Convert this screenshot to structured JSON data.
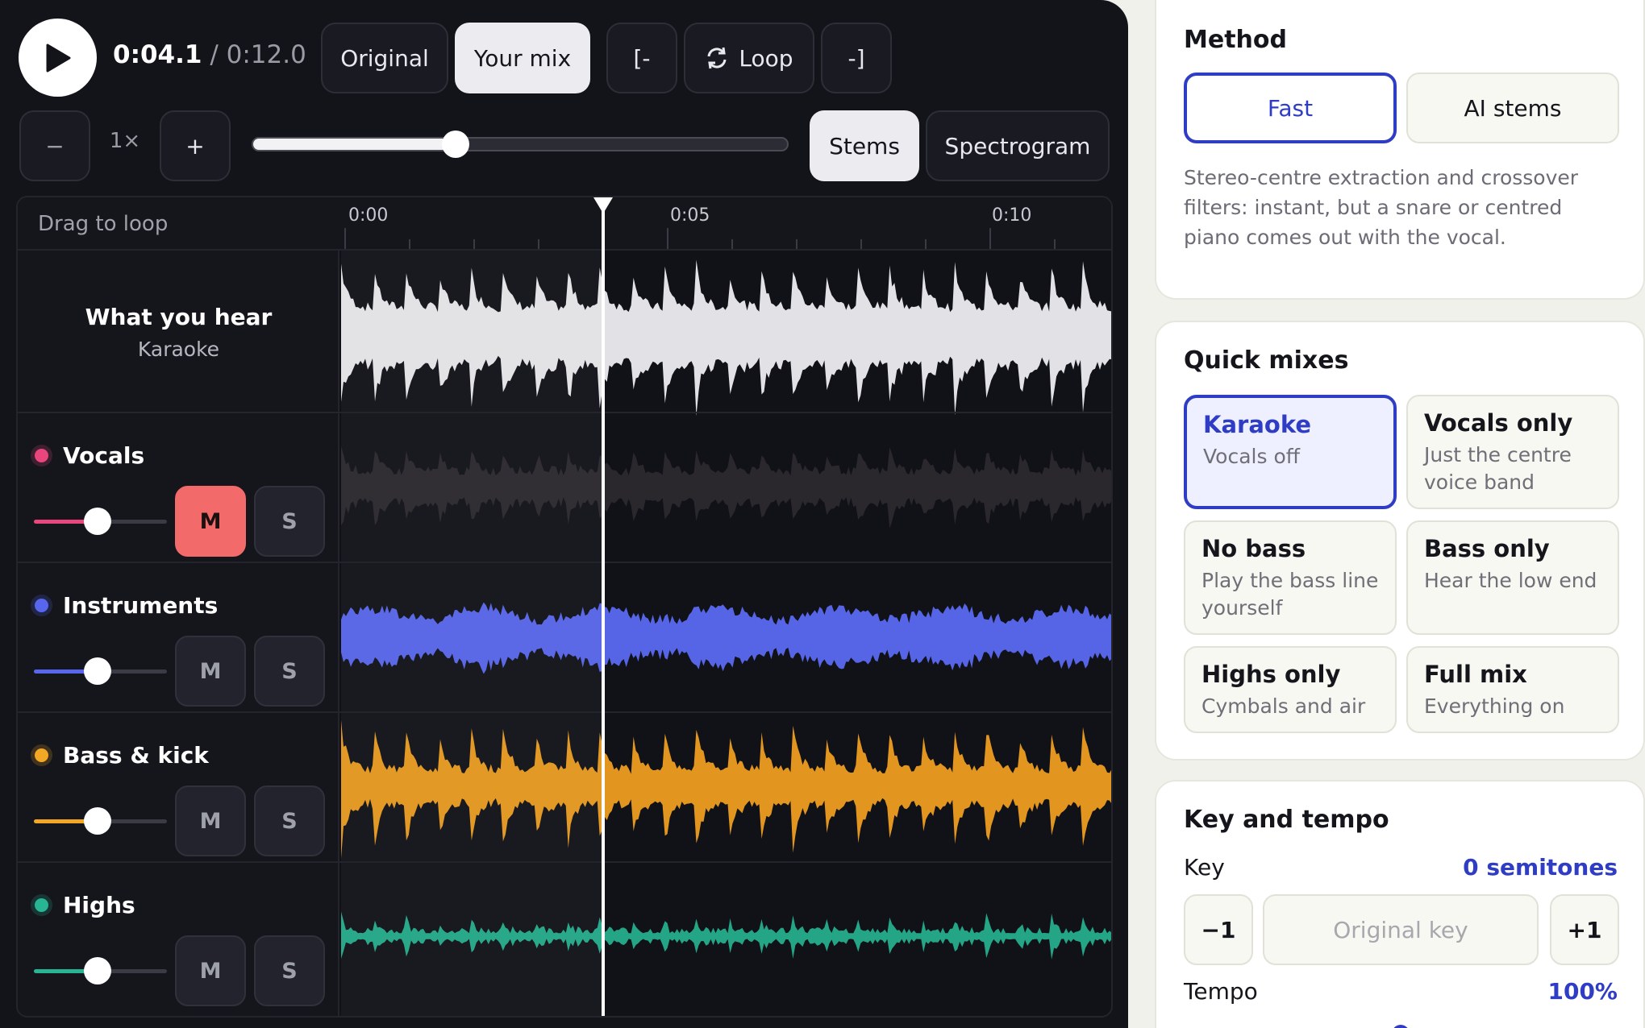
{
  "player": {
    "current_time": "0:04.1",
    "separator": "/",
    "total_time": "0:12.0",
    "mode_original": "Original",
    "mode_mix": "Your mix",
    "loop_start": "[-",
    "loop_label": "Loop",
    "loop_end": "-]",
    "speed_minus": "−",
    "speed_value": "1×",
    "speed_plus": "+",
    "zoom_level": 0.38,
    "view_stems": "Stems",
    "view_spectrogram": "Spectrogram",
    "playhead_time_s": 4.1,
    "duration_s": 12.0
  },
  "timeline": {
    "drag_label": "Drag to loop",
    "ticks": [
      "0:00",
      "0:05",
      "0:10"
    ],
    "hear_title": "What you hear",
    "hear_subtitle": "Karaoke"
  },
  "stems": [
    {
      "name": "Vocals",
      "color": "#e8467c",
      "level": 0.62,
      "mute": "M",
      "solo": "S",
      "muted": true
    },
    {
      "name": "Instruments",
      "color": "#5766ec",
      "level": 0.62,
      "mute": "M",
      "solo": "S",
      "muted": false
    },
    {
      "name": "Bass & kick",
      "color": "#f2a725",
      "level": 0.62,
      "mute": "M",
      "solo": "S",
      "muted": false
    },
    {
      "name": "Highs",
      "color": "#27b594",
      "level": 0.62,
      "mute": "M",
      "solo": "S",
      "muted": false
    }
  ],
  "method": {
    "title": "Method",
    "fast": "Fast",
    "ai": "AI stems",
    "description": "Stereo-centre extraction and crossover filters: instant, but a snare or centred piano comes out with the vocal."
  },
  "quick_mixes": {
    "title": "Quick mixes",
    "items": [
      {
        "title": "Karaoke",
        "subtitle": "Vocals off"
      },
      {
        "title": "Vocals only",
        "subtitle": "Just the centre voice band"
      },
      {
        "title": "No bass",
        "subtitle": "Play the bass line yourself"
      },
      {
        "title": "Bass only",
        "subtitle": "Hear the low end"
      },
      {
        "title": "Highs only",
        "subtitle": "Cymbals and air"
      },
      {
        "title": "Full mix",
        "subtitle": "Everything on"
      }
    ]
  },
  "key_tempo": {
    "title": "Key and tempo",
    "key_label": "Key",
    "key_value": "0 semitones",
    "minus": "−1",
    "original_key": "Original key",
    "plus": "+1",
    "tempo_label": "Tempo",
    "tempo_value": "100%"
  }
}
